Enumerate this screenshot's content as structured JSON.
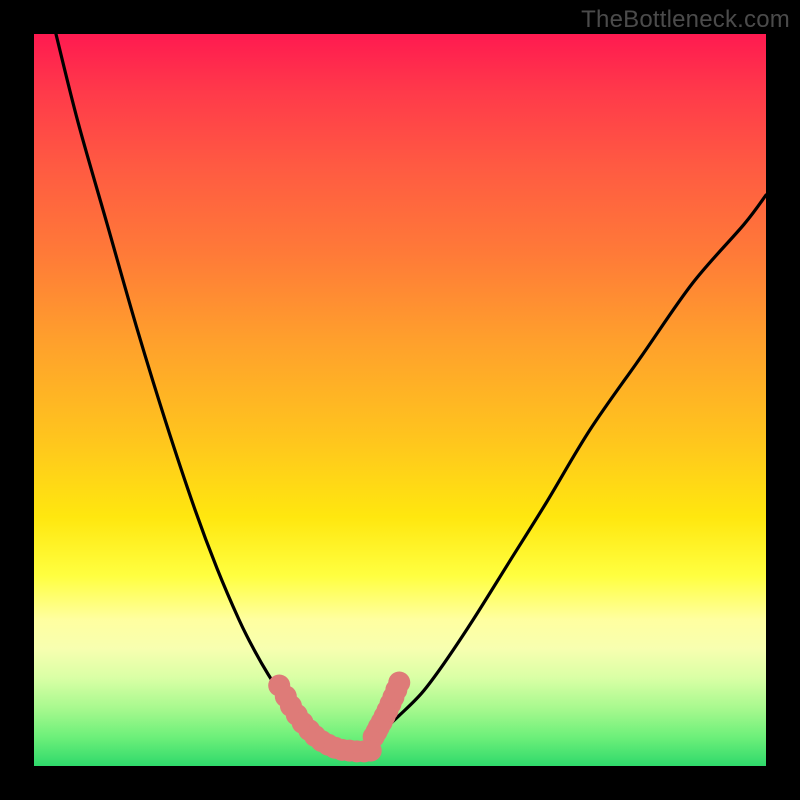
{
  "watermark": {
    "text": "TheBottleneck.com"
  },
  "chart_data": {
    "type": "line",
    "title": "",
    "xlabel": "",
    "ylabel": "",
    "xlim": [
      0,
      100
    ],
    "ylim": [
      0,
      100
    ],
    "grid": false,
    "legend": false,
    "series": [
      {
        "name": "curve-left",
        "color": "#000000",
        "x": [
          3,
          6,
          10,
          14,
          18,
          22,
          25,
          28,
          30,
          32,
          34,
          35.5,
          37,
          38,
          39
        ],
        "values": [
          100,
          88,
          74,
          60,
          47,
          35,
          27,
          20,
          16,
          12.5,
          9.5,
          7.5,
          5.8,
          4.6,
          3.8
        ]
      },
      {
        "name": "curve-right",
        "color": "#000000",
        "x": [
          46,
          48,
          50,
          53,
          56,
          60,
          65,
          70,
          76,
          83,
          90,
          97,
          100
        ],
        "values": [
          3.8,
          5.2,
          7.0,
          10,
          14,
          20,
          28,
          36,
          46,
          56,
          66,
          74,
          78
        ]
      },
      {
        "name": "bottom-marker-left",
        "color": "#de7b78",
        "x": [
          33.5,
          34.4,
          35.1,
          35.9,
          36.7,
          37.6,
          38.4,
          39.3,
          40.2,
          41.1,
          42.1,
          43.1,
          44.1,
          45.1,
          46.0
        ],
        "values": [
          11.0,
          9.5,
          8.2,
          7.0,
          5.9,
          4.9,
          4.1,
          3.4,
          2.9,
          2.5,
          2.2,
          2.1,
          2.0,
          2.0,
          2.1
        ]
      },
      {
        "name": "bottom-marker-right",
        "color": "#de7b78",
        "x": [
          46.4,
          46.8,
          47.1,
          47.5,
          47.9,
          48.3,
          48.7,
          49.1,
          49.5,
          49.9
        ],
        "values": [
          4.0,
          4.7,
          5.3,
          6.0,
          6.8,
          7.6,
          8.5,
          9.4,
          10.4,
          11.4
        ]
      }
    ]
  }
}
